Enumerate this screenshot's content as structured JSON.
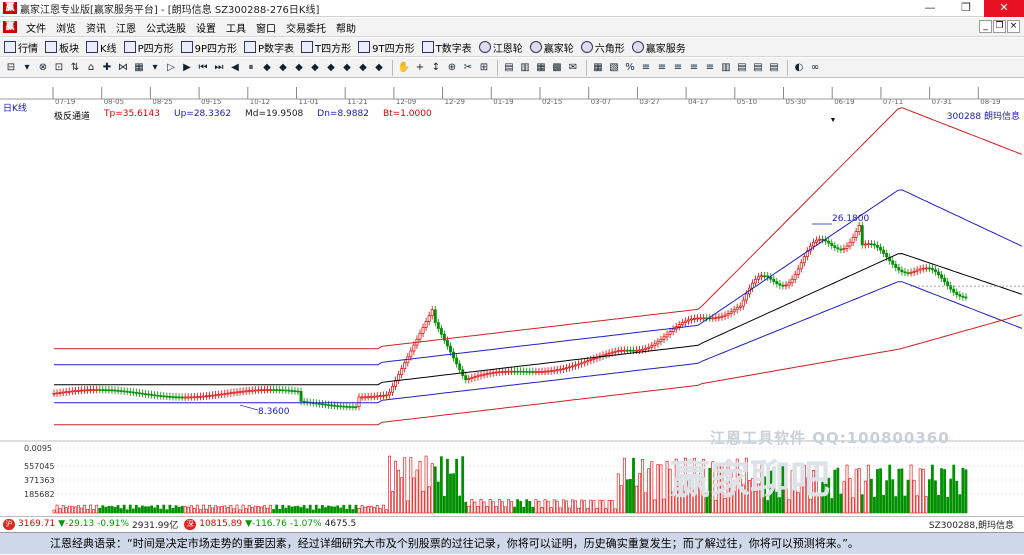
{
  "window": {
    "title": "赢家江恩专业版[赢家服务平台] - [朗玛信息  SZ300288-276日K线]",
    "logo_text": "赢",
    "minimize": "—",
    "maximize": "❐",
    "close": "✕"
  },
  "menu": {
    "items": [
      "文件",
      "浏览",
      "资讯",
      "江恩",
      "公式选股",
      "设置",
      "工具",
      "窗口",
      "交易委托",
      "帮助"
    ],
    "mdi": [
      "_",
      "❐",
      "×"
    ]
  },
  "toolbar1": [
    {
      "icon": "list-icon",
      "label": "行情"
    },
    {
      "icon": "grid-icon",
      "label": "板块"
    },
    {
      "icon": "candle-icon",
      "label": "K线"
    },
    {
      "icon": "p-icon",
      "label": "P四方形"
    },
    {
      "icon": "9p-icon",
      "label": "9P四方形"
    },
    {
      "icon": "pn-icon",
      "label": "P数字表"
    },
    {
      "icon": "t-icon",
      "label": "T四方形"
    },
    {
      "icon": "9t-icon",
      "label": "9T四方形"
    },
    {
      "icon": "tn-icon",
      "label": "T数字表"
    },
    {
      "icon": "wheel-icon",
      "label": "江恩轮"
    },
    {
      "icon": "wheel2-icon",
      "label": "赢家轮"
    },
    {
      "icon": "hexagon-icon",
      "label": "六角形"
    },
    {
      "icon": "dollar-icon",
      "label": "赢家服务"
    }
  ],
  "toolbar2_glyphs": [
    "⊟",
    "▾",
    "⊗",
    "⊡",
    "⇅",
    "⌂",
    "✚",
    "⋈",
    "▦",
    "▾",
    "▷",
    "▶",
    "⏮",
    "⏭",
    "◀",
    "⏸",
    "◆",
    "◆",
    "◆",
    "◆",
    "◆",
    "◆",
    "◆",
    "◆",
    "|",
    "✋",
    "+",
    "↕",
    "⊕",
    "✂",
    "⊞",
    "|",
    "▤",
    "▥",
    "▦",
    "▩",
    "✉",
    "|",
    "▦",
    "▧",
    "%",
    "≡",
    "≡",
    "≡",
    "≡",
    "≡",
    "▥",
    "▤",
    "▤",
    "▤",
    "|",
    "◐",
    "∞"
  ],
  "chart": {
    "period": "日K线",
    "dates": [
      "07-19",
      "08-05",
      "08-25",
      "09-15",
      "10-12",
      "11-01",
      "11-21",
      "12-09",
      "12-29",
      "01-19",
      "02-15",
      "03-07",
      "03-27",
      "04-17",
      "05-10",
      "05-30",
      "06-19",
      "07-11",
      "07-31",
      "08-19"
    ],
    "indicator": {
      "name": "极反通道",
      "tp": "Tp=35.6143",
      "up": "Up=28.3362",
      "md": "Md=19.9508",
      "dn": "Dn=8.9882",
      "bt": "Bt=1.0000"
    },
    "stock": "300288  朗玛信息",
    "max_label": "26.1800",
    "min_label": "8.3600",
    "vol_labels": [
      "0.0095",
      "557045",
      "371363",
      "185682"
    ],
    "colors": {
      "up": "#e00000",
      "down": "#009000",
      "channel_outer": "#d02020",
      "channel_inner": "#2020c0",
      "mid": "#000000"
    }
  },
  "watermark": {
    "line1": "江恩工具软件  QQ:100800360",
    "line2": "赢家聊吧"
  },
  "status": {
    "sh_badge": "沪",
    "sh_value": "3169.71",
    "sh_change": "▼-29.13",
    "sh_pct": "-0.91%",
    "sh_amount": "2931.99亿",
    "sz_badge": "深",
    "sz_value": "10815.89",
    "sz_change": "▼-116.76",
    "sz_pct": "-1.07%",
    "sz_amount": "4675.5",
    "right": "SZ300288,朗玛信息"
  },
  "quote": "江恩经典语录：“时间是决定市场走势的重要因素，经过详细研究大市及个别股票的过往记录，你将可以证明，历史确实重复发生；而了解过往，你将可以预测将来。”。"
}
